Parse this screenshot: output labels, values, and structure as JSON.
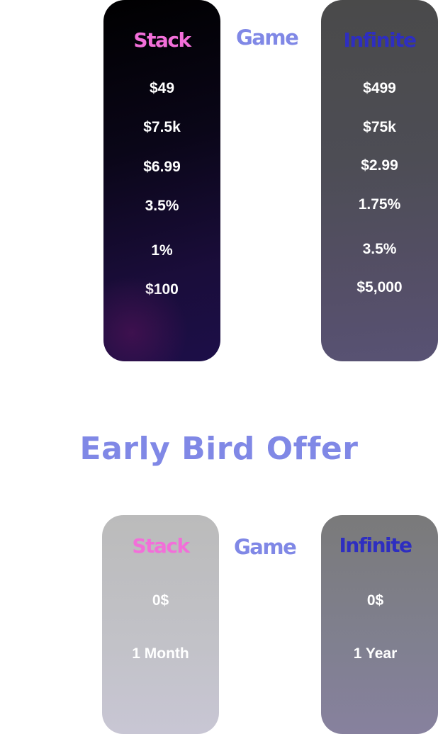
{
  "pricing": {
    "game_label": "Game",
    "stack": {
      "title": "Stack",
      "values": [
        "$49",
        "$7.5k",
        "$6.99",
        "3.5%",
        "1%",
        "$100"
      ]
    },
    "infinite": {
      "title": "Infinite",
      "values": [
        "$499",
        "$75k",
        "$2.99",
        "1.75%",
        "3.5%",
        "$5,000"
      ]
    }
  },
  "early_bird": {
    "heading": "Early Bird Offer",
    "game_label": "Game",
    "stack": {
      "title": "Stack",
      "price": "0$",
      "duration": "1 Month"
    },
    "infinite": {
      "title": "Infinite",
      "price": "0$",
      "duration": "1 Year"
    }
  },
  "colors": {
    "stack_title": "#f26fd9",
    "infinite_title": "#2e2ec0",
    "game_label": "#8088e6",
    "heading": "#8088e6"
  }
}
